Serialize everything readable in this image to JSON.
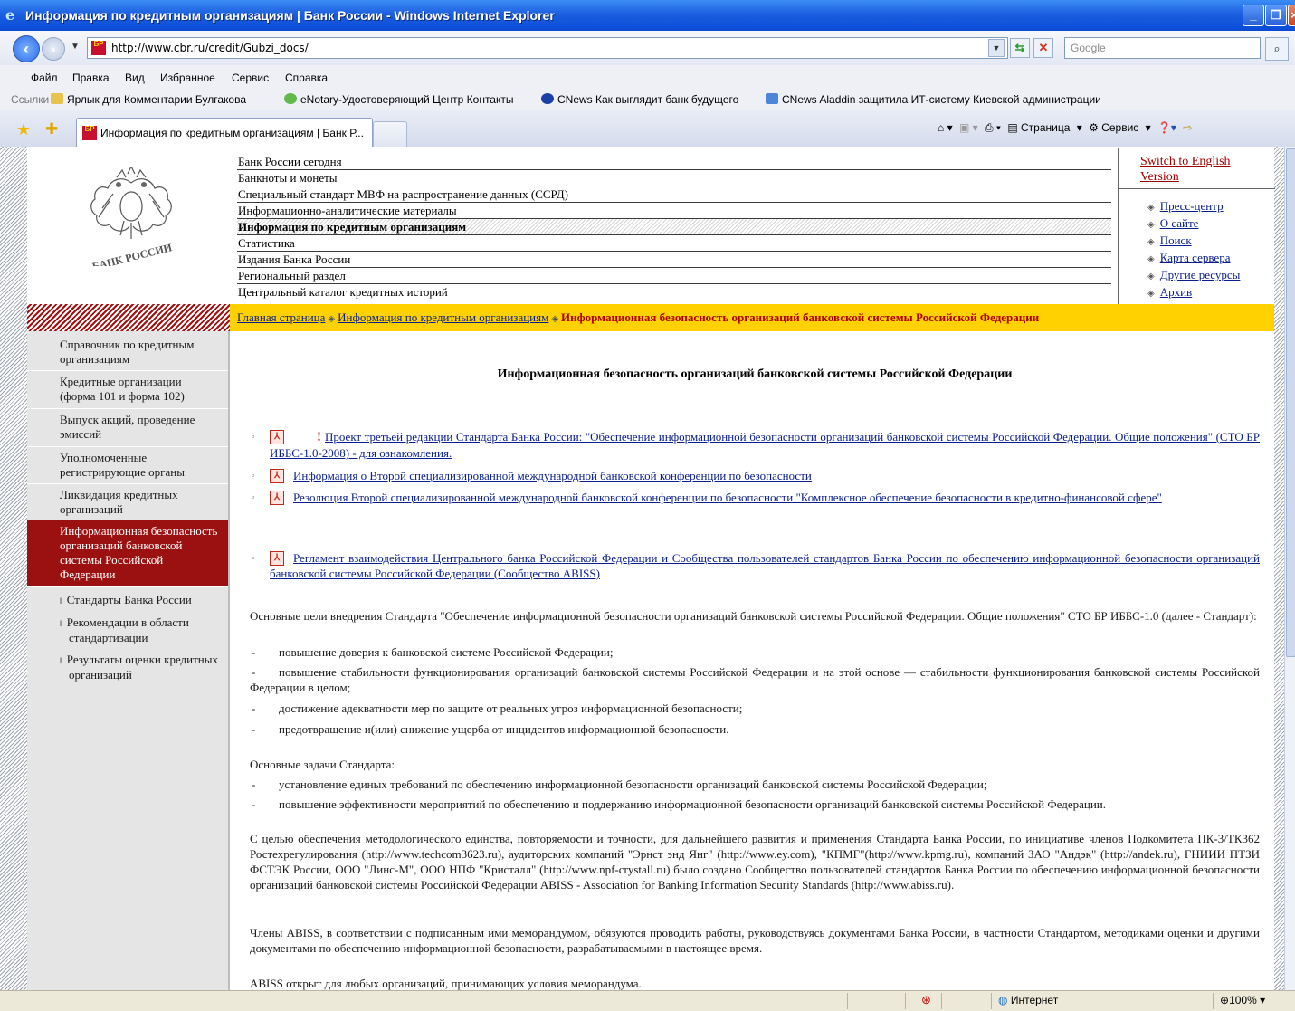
{
  "window": {
    "title": "Информация по кредитным организациям | Банк России - Windows Internet Explorer"
  },
  "address": {
    "url": "http://www.cbr.ru/credit/Gubzi_docs/",
    "search_placeholder": "Google"
  },
  "menu": [
    "Файл",
    "Правка",
    "Вид",
    "Избранное",
    "Сервис",
    "Справка"
  ],
  "links_bar": {
    "label": "Ссылки",
    "items": [
      "Ярлык для Комментарии Булгакова",
      "eNotary-Удостоверяющий Центр Контакты",
      "CNews Как выглядит банк будущего",
      "CNews Aladdin защитила ИТ-систему Киевской администрации"
    ]
  },
  "tab": {
    "title": "Информация по кредитным организациям | Банк Р..."
  },
  "command_bar": {
    "page": "Страница",
    "tools": "Сервис"
  },
  "header": {
    "logo_text": "БАНК РОССИИ",
    "nav": [
      "Банк России сегодня",
      "Банкноты и монеты",
      "Специальный стандарт МВФ на распространение данных (ССРД)",
      "Информационно-аналитические материалы",
      "Информация по кредитным организациям",
      "Статистика",
      "Издания Банка России",
      "Региональный раздел",
      "Центральный каталог кредитных историй"
    ],
    "switch_english": "Switch to English Version",
    "right_links": [
      "Пресс-центр",
      "О сайте",
      "Поиск",
      "Карта сервера",
      "Другие ресурсы",
      "Архив"
    ]
  },
  "breadcrumb": {
    "home": "Главная страница",
    "section": "Информация по кредитным организациям",
    "current": "Информационная безопасность организаций банковской системы Российской Федерации"
  },
  "sidebar": {
    "items": [
      "Справочник по кредитным организациям",
      "Кредитные организации (форма 101 и форма 102)",
      "Выпуск акций, проведение эмиссий",
      "Уполномоченные регистрирующие органы",
      "Ликвидация кредитных организаций",
      "Информационная безопасность организаций банковской системы Российской Федерации"
    ],
    "subitems": [
      "Стандарты Банка России",
      "Рекомендации в области стандартизации",
      "Результаты оценки кредитных организаций"
    ]
  },
  "content": {
    "title": "Информационная безопасность организаций банковской системы Российской Федерации",
    "docs": [
      "Проект третьей редакции Стандарта Банка России: \"Обеспечение информационной безопасности организаций банковской системы Российской Федерации. Общие положения\" (СТО БР ИББС-1.0-2008) - для ознакомления.",
      "Информация о Второй специализированной международной банковской конференции по безопасности",
      "Резолюция Второй специализированной международной банковской конференции по безопасности \"Комплексное обеспечение безопасности в кредитно-финансовой сфере\"",
      "Регламент взаимодействия Центрального банка Российской Федерации и Сообщества пользователей стандартов Банка России по обеспечению информационной безопасности организаций банковской системы Российской Федерации (Сообщество ABISS)"
    ],
    "goals_intro": "Основные цели внедрения Стандарта \"Обеспечение информационной безопасности организаций банковской системы Российской Федерации. Общие положения\" СТО БР ИББС-1.0 (далее - Стандарт):",
    "goals": [
      "повышение доверия к банковской системе Российской Федерации;",
      "повышение стабильности функционирования организаций банковской системы Российской Федерации и на этой основе — стабильности функционирования банковской системы Российской Федерации в целом;",
      "достижение адекватности мер по защите от реальных угроз информационной безопасности;",
      "предотвращение и(или) снижение ущерба от инцидентов информационной безопасности."
    ],
    "tasks_intro": "Основные задачи Стандарта:",
    "tasks": [
      "установление единых требований по обеспечению информационной безопасности организаций банковской системы Российской Федерации;",
      "повышение эффективности мероприятий по обеспечению и поддержанию информационной безопасности организаций банковской системы Российской Федерации."
    ],
    "para1": "С целью обеспечения методологического единства, повторяемости и точности, для дальнейшего развития и применения Стандарта Банка России, по инициативе членов Подкомитета ПК-3/ТК362 Ростехрегулирования (http://www.techcom3623.ru), аудиторских компаний \"Эрнст энд Янг\" (http://www.ey.com), \"КПМГ\"(http://www.kpmg.ru), компаний ЗАО \"Андэк\" (http://andek.ru), ГНИИИ ПТЗИ ФСТЭК России, ООО \"Линс-М\", ООО НПФ \"Кристалл\" (http://www.npf-crystall.ru) было создано Сообщество пользователей стандартов Банка России по обеспечению информационной безопасности организаций банковской системы Российской Федерации ABISS - Association for Banking Information Security Standards (http://www.abiss.ru).",
    "para2": "Члены ABISS, в соответствии с подписанным ими меморандумом, обязуются проводить работы, руководствуясь документами Банка России, в частности Стандартом, методиками оценки и другими документами по обеспечению информационной безопасности, разрабатываемыми в настоящее время.",
    "para3": "ABISS открыт для любых организаций, принимающих условия меморандума."
  },
  "status": {
    "zone": "Интернет",
    "zoom": "100%"
  }
}
